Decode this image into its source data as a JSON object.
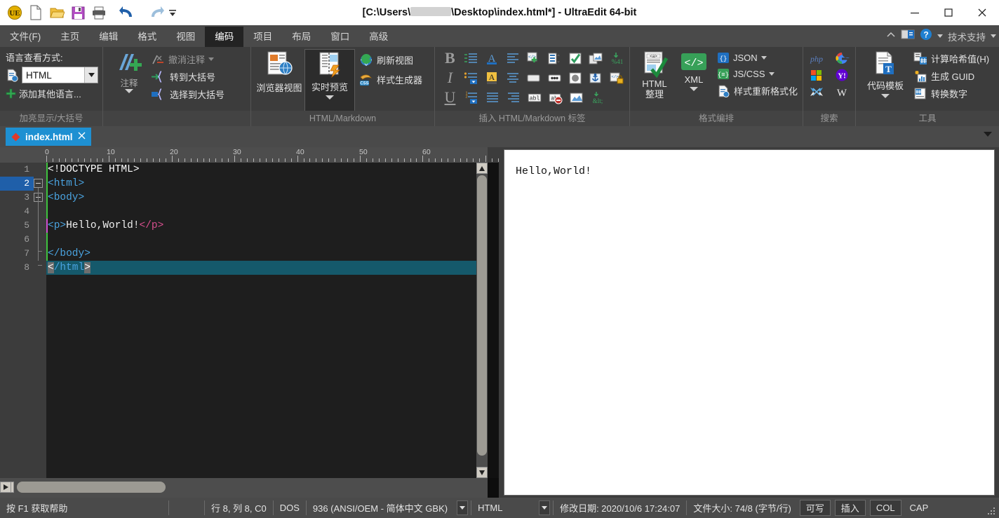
{
  "window": {
    "title_prefix": "[C:\\Users\\",
    "title_suffix": "\\Desktop\\index.html*] - UltraEdit 64-bit",
    "minimize_label": "—",
    "maximize_label": "□",
    "close_label": "×"
  },
  "quick_access": [
    {
      "name": "app-logo-icon",
      "label": "UE"
    },
    {
      "name": "new-file-icon",
      "label": "New"
    },
    {
      "name": "open-file-icon",
      "label": "Open"
    },
    {
      "name": "save-file-icon",
      "label": "Save"
    },
    {
      "name": "print-icon",
      "label": "Print"
    },
    {
      "name": "undo-icon",
      "label": "Undo"
    },
    {
      "name": "redo-icon",
      "label": "Redo"
    },
    {
      "name": "qat-more-icon",
      "label": "More"
    }
  ],
  "menubar": {
    "items": [
      {
        "label": "文件(F)",
        "active": false
      },
      {
        "label": "主页",
        "active": false
      },
      {
        "label": "编辑",
        "active": false
      },
      {
        "label": "格式",
        "active": false
      },
      {
        "label": "视图",
        "active": false
      },
      {
        "label": "编码",
        "active": true
      },
      {
        "label": "项目",
        "active": false
      },
      {
        "label": "布局",
        "active": false
      },
      {
        "label": "窗口",
        "active": false
      },
      {
        "label": "高级",
        "active": false
      }
    ],
    "support_label": "技术支持"
  },
  "ribbon": {
    "group_language": {
      "title": "加亮显示/大括号",
      "header": "语言查看方式:",
      "selected_language": "HTML",
      "add_language_label": "添加其他语言..."
    },
    "group_comment": {
      "comment_label": "注释",
      "uncomment_label": "撤消注释",
      "goto_bracket_label": "转到大括号",
      "select_bracket_label": "选择到大括号"
    },
    "group_html": {
      "title": "HTML/Markdown",
      "browser_view_label": "浏览器视图",
      "live_preview_label": "实时预览",
      "refresh_view_label": "刷新视图",
      "style_builder_label": "样式生成器"
    },
    "group_tags": {
      "title": "插入 HTML/Markdown 标签",
      "row1": [
        "bold-icon",
        "indent-list-icon",
        "font-color-icon",
        "align-left-icon",
        "insert-code-icon",
        "insert-form-icon",
        "checkbox-icon",
        "insert-image-icon",
        "special-char-icon"
      ],
      "row2": [
        "italic-icon",
        "bullet-list-icon",
        "highlight-icon",
        "align-center-icon",
        "text-field-icon",
        "password-field-icon",
        "radio-button-icon",
        "anchor-icon",
        "secure-code-icon"
      ],
      "row3": [
        "underline-icon",
        "numbered-list-icon",
        "align-justify-icon",
        "align-right-icon",
        "label-icon",
        "no-entry-icon",
        "picture-icon",
        "alt-entity-icon"
      ]
    },
    "group_format": {
      "title": "格式编排",
      "html_tidy_line1": "HTML",
      "html_tidy_line2": "整理",
      "xml_label": "XML",
      "json_label": "JSON",
      "jscss_label": "JS/CSS",
      "reformat_label": "样式重新格式化"
    },
    "group_search": {
      "title": "搜索",
      "icons": [
        "php-search-icon",
        "google-search-icon",
        "microsoft-search-icon",
        "yahoo-search-icon",
        "msdn-search-icon",
        "wikipedia-search-icon"
      ]
    },
    "group_tools": {
      "title": "工具",
      "code_template_label": "代码模板",
      "hash_label": "计算哈希值(H)",
      "guid_label": "生成 GUID",
      "convert_number_label": "转换数字"
    }
  },
  "doctab": {
    "label": "index.html",
    "close_label": "×"
  },
  "editor": {
    "ruler_labels": [
      "0",
      "10",
      "20",
      "30",
      "40",
      "50",
      "60"
    ],
    "lines": [
      {
        "num": "1",
        "text": "<!DOCTYPE HTML>"
      },
      {
        "num": "2",
        "text": "<html>"
      },
      {
        "num": "3",
        "text": "<body>"
      },
      {
        "num": "4",
        "text": ""
      },
      {
        "num": "5",
        "text": "<p>Hello,World!</p>"
      },
      {
        "num": "6",
        "text": ""
      },
      {
        "num": "7",
        "text": "</body>"
      },
      {
        "num": "8",
        "text": "</html>"
      }
    ],
    "current_line": "8"
  },
  "preview": {
    "content": "Hello,World!"
  },
  "statusbar": {
    "help_hint": "按 F1 获取帮助",
    "caret": "行 8, 列 8, C0",
    "line_ending": "DOS",
    "codepage": "936  (ANSI/OEM - 简体中文 GBK)",
    "syntax": "HTML",
    "modified_date": "修改日期: 2020/10/6 17:24:07",
    "file_size": "文件大小: 74/8 (字节/行)",
    "writable": "可写",
    "insert_mode": "插入",
    "col_mode": "COL",
    "caps": "CAP"
  },
  "colors": {
    "ribbon_bg": "#3c3c3c",
    "menubar_bg": "#4a4a4a",
    "editor_bg": "#1e1e1e",
    "tab_active": "#1e90d2",
    "current_line": "#15596b",
    "tag_blue": "#4aa3e0",
    "close_pink": "#d84f8e",
    "green_bar": "#3ec23e"
  }
}
